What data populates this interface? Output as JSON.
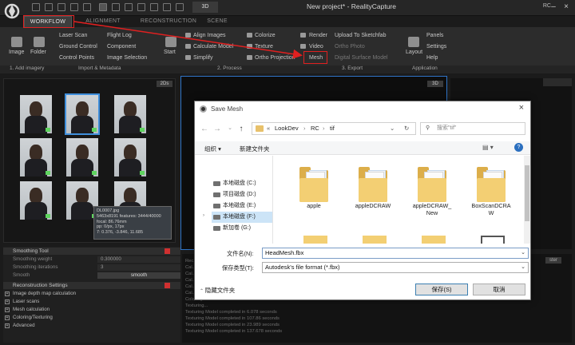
{
  "window": {
    "title": "New project* - RealityCapture",
    "mode_badge": "3D",
    "right_text": "RC",
    "min": "–",
    "max": "□",
    "close": "×"
  },
  "tabs": [
    {
      "label": "WORKFLOW",
      "active": true
    },
    {
      "label": "ALIGNMENT",
      "active": false
    },
    {
      "label": "RECONSTRUCTION",
      "active": false
    },
    {
      "label": "SCENE",
      "active": false
    }
  ],
  "ribbon": {
    "add_imagery": {
      "image": "Image",
      "folder": "Folder",
      "laser_scan": "Laser Scan",
      "ground_control": "Ground Control",
      "control_points": "Control Points",
      "flight_log": "Flight Log",
      "component": "Component",
      "image_selection": "Image Selection"
    },
    "process": {
      "start": "Start",
      "align_images": "Align Images",
      "calculate_model": "Calculate Model",
      "simplify": "Simplify",
      "colorize": "Colorize",
      "texture": "Texture",
      "ortho_projection": "Ortho Projection"
    },
    "export": {
      "render": "Render",
      "video": "Video",
      "mesh": "Mesh",
      "upload_sketchfab": "Upload To Sketchfab",
      "ortho_photo": "Ortho Photo",
      "digital_surface_model": "Digital Surface Model"
    },
    "application": {
      "layout": "Layout",
      "panels": "Panels",
      "settings": "Settings",
      "help": "Help"
    },
    "sections": {
      "s1": "1. Add imagery",
      "s2": "Import & Metadata",
      "s3": "2. Process",
      "s4": "3. Export",
      "s5": "Application"
    }
  },
  "panels": {
    "badge_2d": "2Ds",
    "badge_3d": "3D",
    "badge_dim": "ster"
  },
  "tooltip": {
    "lines": [
      "DL0007.jpg",
      "5463x8191 features: 3444/40000",
      "focal: 86.76mm",
      "pp: 0/px, 17px",
      "7: 0.376, -3.846, 11.685"
    ]
  },
  "settings": {
    "smoothing_tool": "Smoothing Tool",
    "smoothing_weight": {
      "label": "Smoothing weight",
      "value": "0.300000"
    },
    "smoothing_iterations": {
      "label": "Smoothing iterations",
      "value": "3"
    },
    "smooth": {
      "label": "Smooth",
      "value": "smooth"
    },
    "reconstruction_settings": "Reconstruction Settings",
    "items": [
      "Image depth map calculation",
      "Laser scans",
      "Mesh calculation",
      "Coloring/Texturing",
      "Advanced"
    ]
  },
  "console": {
    "lines": [
      "Rec...",
      "Cal...",
      "Cal...",
      "Cal...",
      "Cal...",
      "Cal...",
      "Coloring...",
      "Texturing...",
      "Texturing Model completed in 6.078 seconds",
      "Texturing Model completed in 107.86 seconds",
      "Texturing Model completed in 23.989 seconds",
      "Texturing Model completed in 137.678 seconds"
    ]
  },
  "dialog": {
    "title": "Save Mesh",
    "close": "×",
    "path": [
      "«",
      "LookDev",
      "RC",
      "tif"
    ],
    "search_placeholder": "搜索\"tif\"",
    "organize": "组织 ▾",
    "new_folder": "新建文件夹",
    "nav_items": [
      {
        "label": "本地磁盘 (C:)",
        "selected": false
      },
      {
        "label": "项目磁盘 (D:)",
        "selected": false
      },
      {
        "label": "本地磁盘 (E:)",
        "selected": false
      },
      {
        "label": "本地磁盘 (F:)",
        "selected": true
      },
      {
        "label": "新加卷 (G:)",
        "selected": false
      }
    ],
    "files": [
      {
        "name": "apple",
        "name2": ""
      },
      {
        "name": "appleDCRAW",
        "name2": ""
      },
      {
        "name": "appleDCRAW_",
        "name2": "New"
      },
      {
        "name": "BoxScanDCRA",
        "name2": "W"
      }
    ],
    "filename_label": "文件名(N):",
    "filename_value": "HeadMesh.fbx",
    "filetype_label": "保存类型(T):",
    "filetype_value": "Autodesk's file format (*.fbx)",
    "hide_folders": "隐藏文件夹",
    "save": "保存(S)",
    "cancel": "取消"
  },
  "colors": {
    "annotation": "#e02020",
    "selection": "#3f8fdc"
  }
}
